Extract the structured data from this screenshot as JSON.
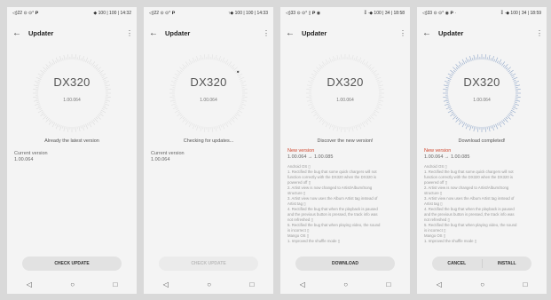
{
  "screens": [
    {
      "status": {
        "left": "◁)22 ⊙ ⊙° 𝗣",
        "right": "◆ 100 | 100 | 14:32"
      },
      "appbar": {
        "back_icon": "←",
        "title": "Updater",
        "menu_icon": "⋮"
      },
      "model": "DX320",
      "version": "1.00.064",
      "status_message": "Already the latest version",
      "current_version_label": "Current version",
      "current_version_value": "1.00.064",
      "button_label": "CHECK UPDATE",
      "nav": {
        "back": "◁",
        "home": "○",
        "recents": "□"
      }
    },
    {
      "status": {
        "left": "◁)22 ⊙ ⊙° 𝗣",
        "right": "↑◆ 100 | 100 | 14:33"
      },
      "appbar": {
        "back_icon": "←",
        "title": "Updater",
        "menu_icon": "⋮"
      },
      "model": "DX320",
      "version": "1.00.064",
      "status_message": "Checking for updates...",
      "current_version_label": "Current version",
      "current_version_value": "1.00.064",
      "button_label": "CHECK UPDATE",
      "nav": {
        "back": "◁",
        "home": "○",
        "recents": "□"
      }
    },
    {
      "status": {
        "left": "◁)33 ⊙ ⊙° ▯ 𝗣 ◉",
        "right": "⁑ ·◆ 100 | 34 | 18:58"
      },
      "appbar": {
        "back_icon": "←",
        "title": "Updater",
        "menu_icon": "⋮"
      },
      "model": "DX320",
      "version": "1.00.064",
      "status_message": "Discover the new version!",
      "new_version_label": "New version",
      "new_version_value": "1.00.064 → 1.00.085",
      "notes": [
        "Android OS ▯",
        "1. Rectified the bug that some quick chargers will not",
        "function correctly with the DX320 when the DX320 is",
        "powered off ▯",
        "2. Artist view is now changed to Artist/Album/Song",
        "structure ▯",
        "3. Artist view now uses the Album Artist tag instead of",
        "Artist tag ▯",
        "4. Rectified the bug that when the playback is paused",
        "and the previous button is pressed, the track info was",
        "not refreshed ▯",
        "5. Rectified the bug that when playing video, the sound",
        "is incorrect ▯",
        "Mango OS ▯",
        "1. Improved the shuffle mode ▯"
      ],
      "button_label": "DOWNLOAD",
      "nav": {
        "back": "◁",
        "home": "○",
        "recents": "□"
      }
    },
    {
      "status": {
        "left": "◁)33 ⊙ ⊙° ◉ 𝗣 ·",
        "right": "⁑ ·◆ 100 | 34 | 18:59"
      },
      "appbar": {
        "back_icon": "←",
        "title": "Updater",
        "menu_icon": "⋮"
      },
      "model": "DX320",
      "version": "1.00.064",
      "status_message": "Download completed!",
      "new_version_label": "New version",
      "new_version_value": "1.00.064 → 1.00.085",
      "notes": [
        "Android OS ▯",
        "1. Rectified the bug that some quick chargers will not",
        "function correctly with the DX320 when the DX320 is",
        "powered off ▯",
        "2. Artist view is now changed to Artist/Album/Song",
        "structure ▯",
        "3. Artist view now uses the Album Artist tag instead of",
        "Artist tag ▯",
        "4. Rectified the bug that when the playback is paused",
        "and the previous button is pressed, the track info was",
        "not refreshed ▯",
        "5. Rectified the bug that when playing video, the sound",
        "is incorrect ▯",
        "Mango OS ▯",
        "1. Improved the shuffle mode ▯"
      ],
      "cancel_label": "CANCEL",
      "install_label": "INSTALL",
      "nav": {
        "back": "◁",
        "home": "○",
        "recents": "□"
      }
    }
  ],
  "colors": {
    "accent_new": "#d0452c",
    "ring_idle": "#dcdcdc",
    "ring_done": "#8fa6c8"
  }
}
